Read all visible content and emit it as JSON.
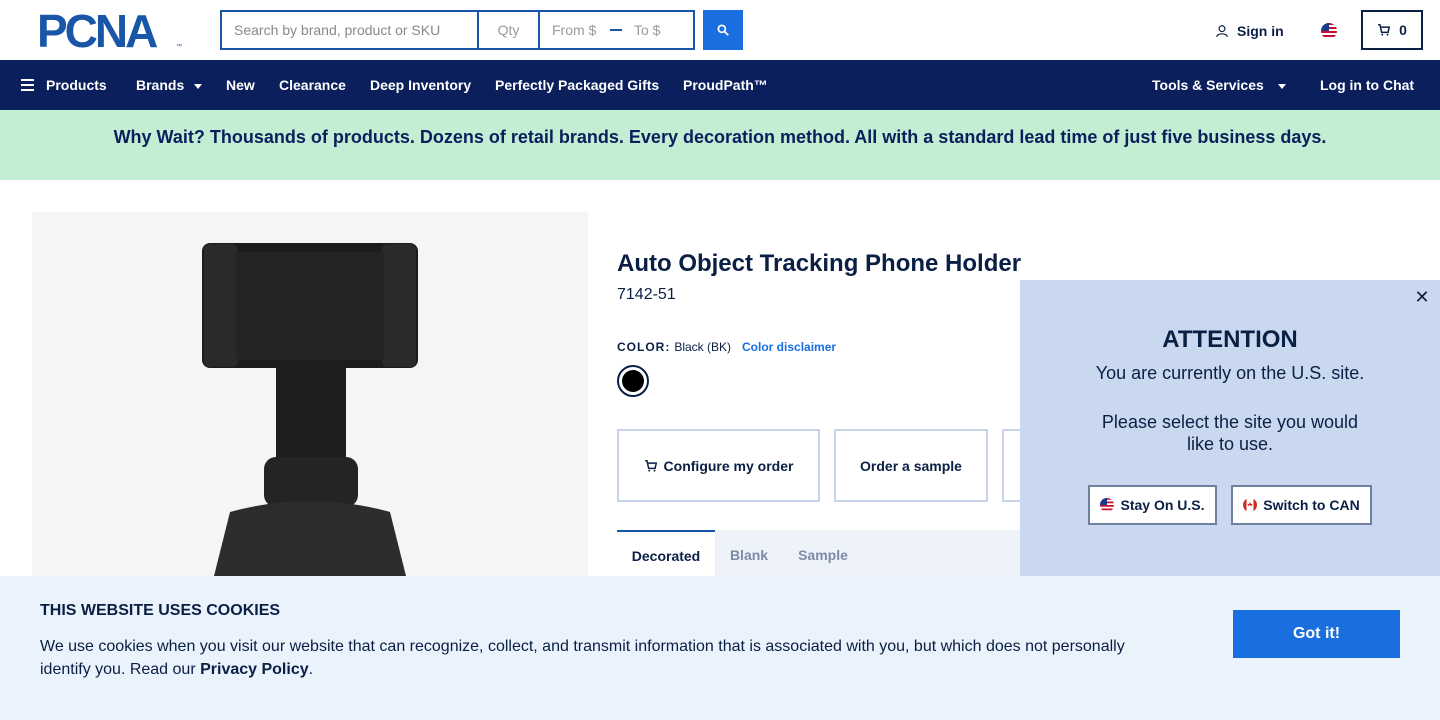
{
  "header": {
    "logo_text": "PCNA",
    "logo_tm": "™",
    "search_placeholder": "Search by brand, product or SKU",
    "qty_placeholder": "Qty",
    "from_placeholder": "From $",
    "to_placeholder": "To $",
    "signin_label": "Sign in",
    "cart_count": "0"
  },
  "nav": {
    "products": "Products",
    "brands": "Brands",
    "new": "New",
    "clearance": "Clearance",
    "deep_inventory": "Deep Inventory",
    "gifts": "Perfectly Packaged Gifts",
    "proudpath": "ProudPath™",
    "tools": "Tools & Services",
    "chat": "Log in to Chat"
  },
  "banner": {
    "text": "Why Wait? Thousands of products. Dozens of retail brands. Every decoration method. All with a standard lead time of just five business days."
  },
  "product": {
    "title": "Auto Object Tracking Phone Holder",
    "sku": "7142-51",
    "color_label": "COLOR:",
    "color_value": "Black (BK)",
    "color_disclaimer": "Color disclaimer",
    "swatch_color": "#000000",
    "configure_label": "Configure my order",
    "sample_label": "Order a sample",
    "tabs": [
      "Decorated",
      "Blank",
      "Sample"
    ]
  },
  "popup": {
    "title": "ATTENTION",
    "line1": "You are currently on the U.S. site.",
    "line2": "Please select the site you would",
    "line3": "like to use.",
    "stay_label": "Stay On U.S.",
    "switch_label": "Switch to CAN"
  },
  "cookie": {
    "title": "THIS WEBSITE USES COOKIES",
    "text_before": "We use cookies when you visit our website that can recognize, collect, and transmit information that is associated with you, but which does not personally identify you. Read our ",
    "link": "Privacy Policy",
    "text_after": ".",
    "button": "Got it!"
  },
  "colors": {
    "nav_bg": "#0a1f5c",
    "accent": "#1a6fe0",
    "banner_bg": "#c3eed4",
    "popup_bg": "#c9d8ee",
    "cookie_bg": "#eaf2fb"
  }
}
